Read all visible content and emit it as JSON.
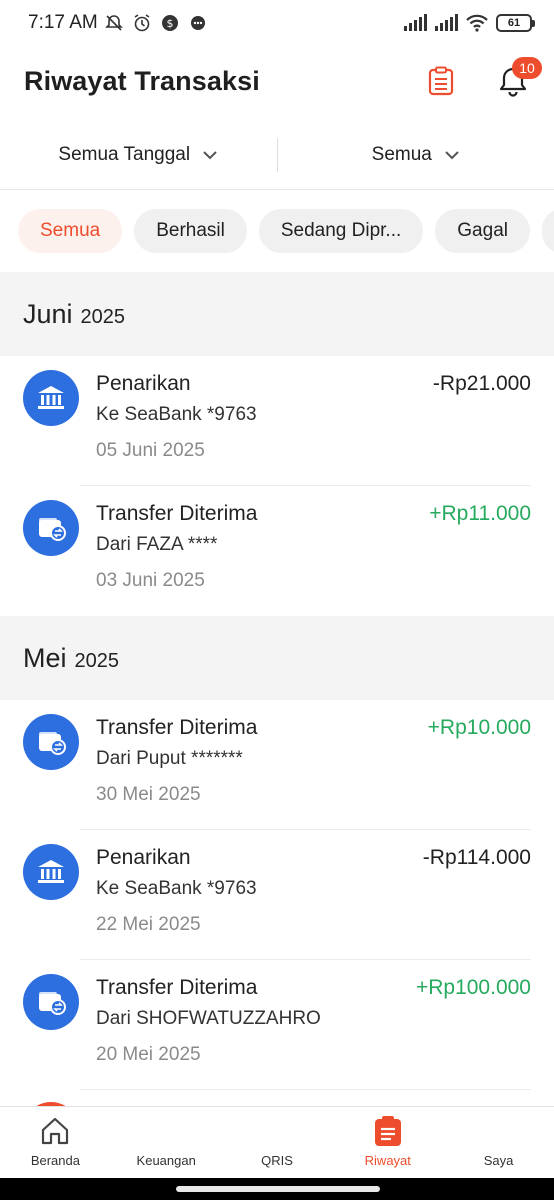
{
  "status_bar": {
    "time": "7:17 AM",
    "battery": "61",
    "icons": [
      "mute-icon",
      "alarm-icon",
      "coin-icon",
      "chat-icon",
      "signal-icon",
      "signal-icon",
      "wifi-icon",
      "battery-icon"
    ]
  },
  "header": {
    "title": "Riwayat Transaksi",
    "notification_count": "10",
    "icons": [
      "clipboard-icon",
      "bell-icon"
    ]
  },
  "filters": {
    "date_label": "Semua Tanggal",
    "type_label": "Semua"
  },
  "chips": [
    {
      "label": "Semua",
      "active": true
    },
    {
      "label": "Berhasil",
      "active": false
    },
    {
      "label": "Sedang Dipr...",
      "active": false
    },
    {
      "label": "Gagal",
      "active": false
    }
  ],
  "sections": [
    {
      "month": "Juni",
      "year": "2025",
      "transactions": [
        {
          "icon": "bank-icon",
          "title": "Penarikan",
          "subtitle": "Ke SeaBank *9763",
          "date": "05 Juni 2025",
          "amount": "-Rp21.000",
          "positive": false
        },
        {
          "icon": "wallet-transfer-icon",
          "title": "Transfer Diterima",
          "subtitle": "Dari FAZA ****",
          "date": "03 Juni 2025",
          "amount": "+Rp11.000",
          "positive": true
        }
      ]
    },
    {
      "month": "Mei",
      "year": "2025",
      "transactions": [
        {
          "icon": "wallet-transfer-icon",
          "title": "Transfer Diterima",
          "subtitle": "Dari Puput *******",
          "date": "30 Mei 2025",
          "amount": "+Rp10.000",
          "positive": true
        },
        {
          "icon": "bank-icon",
          "title": "Penarikan",
          "subtitle": "Ke SeaBank *9763",
          "date": "22 Mei 2025",
          "amount": "-Rp114.000",
          "positive": false
        },
        {
          "icon": "wallet-transfer-icon",
          "title": "Transfer Diterima",
          "subtitle": "Dari SHOFWATUZZAHRO",
          "date": "20 Mei 2025",
          "amount": "+Rp100.000",
          "positive": true
        }
      ]
    }
  ],
  "bottom_nav": [
    {
      "label": "Beranda",
      "icon": "home-icon",
      "active": false
    },
    {
      "label": "Keuangan",
      "icon": "",
      "active": false
    },
    {
      "label": "QRIS",
      "icon": "",
      "active": false
    },
    {
      "label": "Riwayat",
      "icon": "history-icon",
      "active": true
    },
    {
      "label": "Saya",
      "icon": "",
      "active": false
    }
  ],
  "colors": {
    "accent": "#ee4d2d",
    "positive": "#26aa5e",
    "icon_blue": "#2e6fe0"
  }
}
